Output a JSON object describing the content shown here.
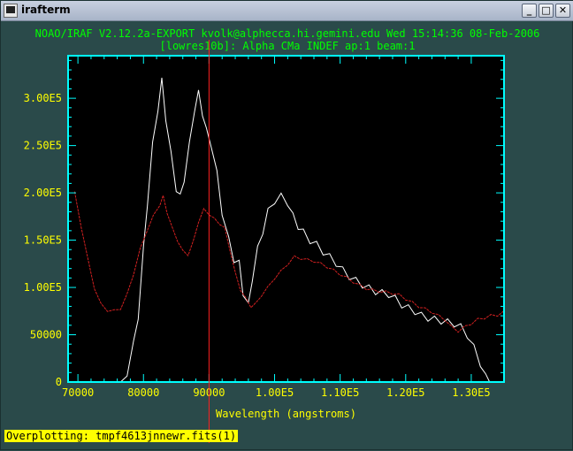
{
  "window": {
    "title": "irafterm",
    "buttons": {
      "minimize": "_",
      "maximize": "□",
      "close": "✕"
    }
  },
  "header": {
    "line1": "NOAO/IRAF V2.12.2a-EXPORT kvolk@alphecca.hi.gemini.edu Wed 15:14:36 08-Feb-2006",
    "line2": "[lowres10b]: Alpha CMa INDEF ap:1 beam:1"
  },
  "status_bar": "Overplotting: tmpf4613jnnewr.fits(1)",
  "colors": {
    "axes": "#00ffff",
    "ticklabels": "#ffff00",
    "header": "#00ff00",
    "series1": "#ffffff",
    "series2": "#d22020",
    "cursor": "#ff2020"
  },
  "chart_data": {
    "type": "line",
    "xlabel": "Wavelength (angstroms)",
    "ylabel": "",
    "xlim": [
      68500,
      135000
    ],
    "ylim": [
      0,
      345000
    ],
    "xticks": [
      70000,
      80000,
      90000,
      100000,
      110000,
      120000,
      130000
    ],
    "xtick_labels": [
      "70000",
      "80000",
      "90000",
      "1.00E5",
      "1.10E5",
      "1.20E5",
      "1.30E5"
    ],
    "yticks": [
      0,
      50000,
      100000,
      150000,
      200000,
      250000,
      300000
    ],
    "ytick_labels": [
      "0",
      "50000",
      "1.00E5",
      "1.50E5",
      "2.00E5",
      "2.50E5",
      "3.00E5"
    ],
    "cursor_x": 90000,
    "series": [
      {
        "x": [
          76500,
          77500,
          78500,
          79200,
          80000,
          80600,
          81400,
          82200,
          82800,
          83400,
          84200,
          85000,
          85600,
          86200,
          87000,
          87800,
          88400,
          89000,
          89600,
          90400,
          91200,
          92000,
          93000,
          93800,
          94600,
          95200,
          96000,
          96600,
          97400,
          98200,
          99000,
          100000,
          101000,
          102000,
          102800,
          103600,
          104400,
          105400,
          106400,
          107400,
          108400,
          109400,
          110400,
          111400,
          112400,
          113400,
          114400,
          115400,
          116400,
          117400,
          118400,
          119400,
          120400,
          121400,
          122400,
          123400,
          124400,
          125400,
          126400,
          127400,
          128400,
          129400,
          130400,
          131400,
          132200,
          132800
        ],
        "values": [
          0,
          10000,
          40000,
          70000,
          140000,
          190000,
          250000,
          290000,
          318000,
          280000,
          240000,
          205000,
          195000,
          215000,
          250000,
          290000,
          305000,
          285000,
          265000,
          250000,
          220000,
          180000,
          150000,
          130000,
          125000,
          95000,
          80000,
          110000,
          140000,
          160000,
          180000,
          192000,
          196000,
          190000,
          175000,
          165000,
          158000,
          150000,
          145000,
          138000,
          132000,
          126000,
          118000,
          112000,
          107000,
          103000,
          99000,
          96000,
          94000,
          93000,
          88000,
          82000,
          78000,
          75000,
          70000,
          68000,
          66000,
          65000,
          63000,
          62000,
          58000,
          50000,
          36000,
          20000,
          5000,
          0
        ]
      },
      {
        "x": [
          69500,
          70500,
          71500,
          72500,
          73500,
          74500,
          75500,
          76500,
          77500,
          78500,
          79500,
          80500,
          81500,
          82500,
          83000,
          83600,
          84400,
          85200,
          86000,
          86800,
          87600,
          88400,
          89200,
          90000,
          90800,
          91600,
          92400,
          93200,
          94000,
          94800,
          95600,
          96400,
          97200,
          98000,
          99000,
          100000,
          101000,
          102000,
          103000,
          104000,
          105000,
          106000,
          107000,
          108000,
          109000,
          110000,
          111000,
          112000,
          113000,
          114000,
          115000,
          116000,
          117000,
          118000,
          119000,
          120000,
          121000,
          122000,
          123000,
          124000,
          125000,
          126000,
          127000,
          128000,
          129000,
          130000,
          131000,
          132000,
          133000,
          134000,
          135000
        ],
        "values": [
          200000,
          165000,
          130000,
          100000,
          82000,
          76000,
          75000,
          78000,
          92000,
          115000,
          140000,
          160000,
          175000,
          188000,
          196000,
          180000,
          162000,
          150000,
          138000,
          135000,
          148000,
          170000,
          182000,
          178000,
          172000,
          168000,
          162000,
          140000,
          115000,
          98000,
          88000,
          80000,
          83000,
          92000,
          100000,
          110000,
          117000,
          125000,
          132000,
          131000,
          129000,
          128000,
          125000,
          122000,
          118000,
          114000,
          110000,
          106000,
          102000,
          99000,
          97000,
          96000,
          95000,
          94000,
          92000,
          88000,
          84000,
          80000,
          77000,
          74000,
          70000,
          66000,
          58000,
          54000,
          58000,
          62000,
          66000,
          68000,
          70000,
          71000,
          74000
        ]
      }
    ]
  }
}
